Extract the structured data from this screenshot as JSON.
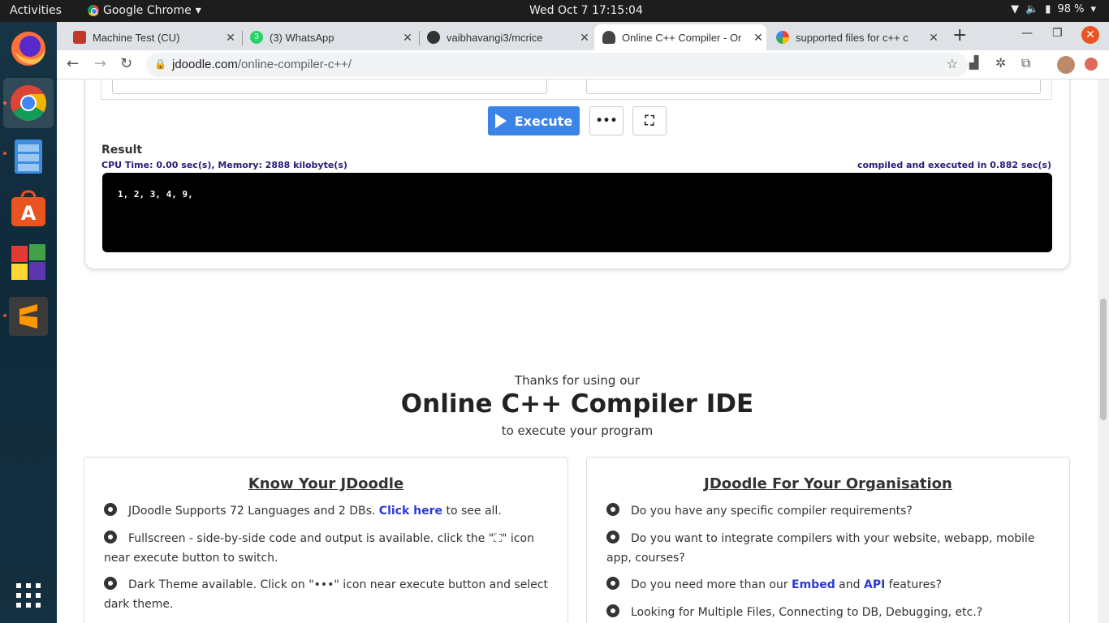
{
  "system": {
    "activities": "Activities",
    "app_name": "Google Chrome",
    "clock": "Wed Oct 7  17:15:04",
    "battery": "98 %"
  },
  "tabs": [
    {
      "title": "Machine Test (CU)",
      "favicon": "grid-icon",
      "color": "#c0392b"
    },
    {
      "title": "(3) WhatsApp",
      "favicon": "whatsapp-icon",
      "color": "#25d366",
      "badge": "3"
    },
    {
      "title": "vaibhavangi3/mcrice",
      "favicon": "github-icon",
      "color": "#333333"
    },
    {
      "title": "Online C++ Compiler - Or",
      "favicon": "jdoodle-icon",
      "color": "#444444",
      "active": true
    },
    {
      "title": "supported files for c++ c",
      "favicon": "google-icon",
      "color": "#4285f4"
    }
  ],
  "address": {
    "host": "jdoodle.com",
    "path": "/online-compiler-c++/"
  },
  "editor": {
    "execute_label": "Execute",
    "more_label": "•••",
    "fullscreen_label": "⛶"
  },
  "result": {
    "label": "Result",
    "cpu": "CPU Time: 0.00 sec(s), Memory: 2888 kilobyte(s)",
    "compiled": "compiled and executed in 0.882 sec(s)",
    "output": "1, 2, 3, 4, 9,"
  },
  "thanks": {
    "line1": "Thanks for using our",
    "title": "Online C++ Compiler IDE",
    "line3": "to execute your program"
  },
  "know": {
    "title": "Know Your JDoodle",
    "items": [
      {
        "a": "JDoodle Supports 72 Languages and 2 DBs. ",
        "link": "Click here",
        "b": " to see all."
      },
      {
        "a": "Fullscreen - side-by-side code and output is available. click the \"⛶\" icon near execute button to switch."
      },
      {
        "a": "Dark Theme available. Click on \"•••\" icon near execute button and select dark theme."
      }
    ]
  },
  "org": {
    "title": "JDoodle For Your Organisation",
    "items": [
      {
        "a": "Do you have any specific compiler requirements?"
      },
      {
        "a": "Do you want to integrate compilers with your website, webapp, mobile app, courses?"
      },
      {
        "a": "Do you need more than our ",
        "link1": "Embed",
        "mid": " and ",
        "link2": "API",
        "b": " features?"
      },
      {
        "a": "Looking for Multiple Files, Connecting to DB, Debugging, etc.?"
      }
    ]
  },
  "colors": {
    "accent": "#3c83e8",
    "link": "#2b3ad6",
    "status_text": "#2a1a7a"
  }
}
